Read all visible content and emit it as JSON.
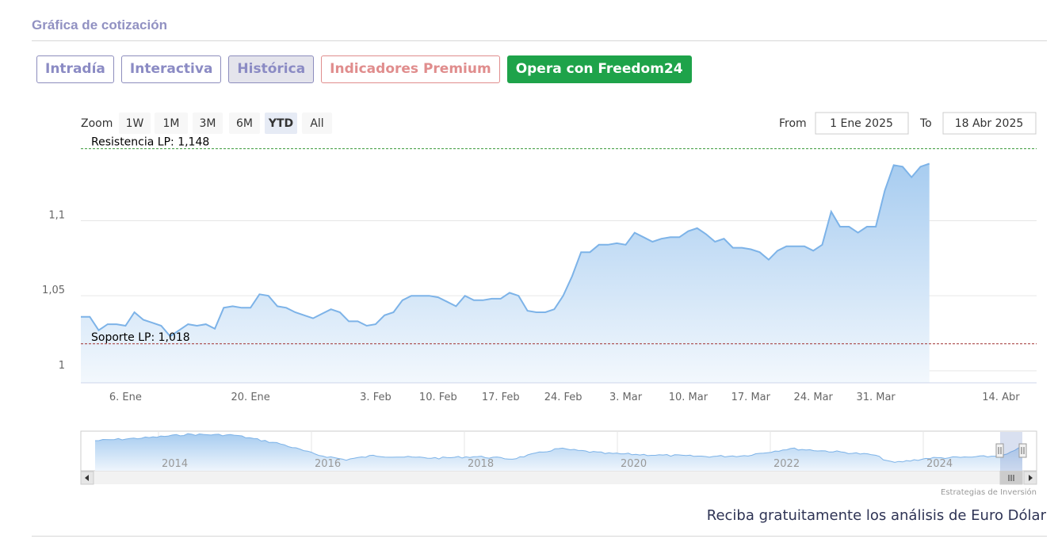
{
  "section": {
    "title": "Gráfica de cotización",
    "tabs": [
      {
        "label": "Intradía",
        "active": false
      },
      {
        "label": "Interactiva",
        "active": false
      },
      {
        "label": "Histórica",
        "active": true
      },
      {
        "label": "Indicadores Premium",
        "active": false
      },
      {
        "label": "Opera con Freedom24",
        "active": false
      }
    ]
  },
  "range_selector": {
    "zoom_label": "Zoom",
    "buttons": [
      "1W",
      "1M",
      "3M",
      "6M",
      "YTD",
      "All"
    ],
    "selected": "YTD",
    "from_label": "From",
    "from_value": "1 Ene 2025",
    "to_label": "To",
    "to_value": "18 Abr 2025"
  },
  "chart_data": {
    "type": "area",
    "ylim": [
      0.992,
      1.152
    ],
    "y_ticks": [
      {
        "value": 1.0,
        "label": "1"
      },
      {
        "value": 1.05,
        "label": "1,05"
      },
      {
        "value": 1.1,
        "label": "1,1"
      }
    ],
    "x_range": [
      0,
      107
    ],
    "x_ticks": [
      {
        "day": 5,
        "label": "6. Ene"
      },
      {
        "day": 19,
        "label": "20. Ene"
      },
      {
        "day": 33,
        "label": "3. Feb"
      },
      {
        "day": 40,
        "label": "10. Feb"
      },
      {
        "day": 47,
        "label": "17. Feb"
      },
      {
        "day": 54,
        "label": "24. Feb"
      },
      {
        "day": 61,
        "label": "3. Mar"
      },
      {
        "day": 68,
        "label": "10. Mar"
      },
      {
        "day": 75,
        "label": "17. Mar"
      },
      {
        "day": 82,
        "label": "24. Mar"
      },
      {
        "day": 89,
        "label": "31. Mar"
      },
      {
        "day": 103,
        "label": "14. Abr"
      }
    ],
    "series": [
      {
        "values": [
          [
            0,
            1.036
          ],
          [
            1,
            1.036
          ],
          [
            2,
            1.027
          ],
          [
            3,
            1.031
          ],
          [
            4,
            1.031
          ],
          [
            5,
            1.03
          ],
          [
            6,
            1.039
          ],
          [
            7,
            1.034
          ],
          [
            8,
            1.032
          ],
          [
            9,
            1.03
          ],
          [
            10,
            1.023
          ],
          [
            11,
            1.027
          ],
          [
            12,
            1.031
          ],
          [
            13,
            1.03
          ],
          [
            14,
            1.031
          ],
          [
            15,
            1.028
          ],
          [
            16,
            1.042
          ],
          [
            17,
            1.043
          ],
          [
            18,
            1.042
          ],
          [
            19,
            1.042
          ],
          [
            20,
            1.051
          ],
          [
            21,
            1.05
          ],
          [
            22,
            1.043
          ],
          [
            23,
            1.042
          ],
          [
            24,
            1.039
          ],
          [
            25,
            1.037
          ],
          [
            26,
            1.035
          ],
          [
            27,
            1.038
          ],
          [
            28,
            1.041
          ],
          [
            29,
            1.039
          ],
          [
            30,
            1.033
          ],
          [
            31,
            1.033
          ],
          [
            32,
            1.03
          ],
          [
            33,
            1.031
          ],
          [
            34,
            1.037
          ],
          [
            35,
            1.039
          ],
          [
            36,
            1.047
          ],
          [
            37,
            1.05
          ],
          [
            38,
            1.05
          ],
          [
            39,
            1.05
          ],
          [
            40,
            1.049
          ],
          [
            41,
            1.046
          ],
          [
            42,
            1.043
          ],
          [
            43,
            1.05
          ],
          [
            44,
            1.047
          ],
          [
            45,
            1.047
          ],
          [
            46,
            1.048
          ],
          [
            47,
            1.048
          ],
          [
            48,
            1.052
          ],
          [
            49,
            1.05
          ],
          [
            50,
            1.04
          ],
          [
            51,
            1.039
          ],
          [
            52,
            1.039
          ],
          [
            53,
            1.041
          ],
          [
            54,
            1.05
          ],
          [
            55,
            1.063
          ],
          [
            56,
            1.079
          ],
          [
            57,
            1.079
          ],
          [
            58,
            1.084
          ],
          [
            59,
            1.084
          ],
          [
            60,
            1.085
          ],
          [
            61,
            1.084
          ],
          [
            62,
            1.092
          ],
          [
            63,
            1.089
          ],
          [
            64,
            1.086
          ],
          [
            65,
            1.088
          ],
          [
            66,
            1.089
          ],
          [
            67,
            1.089
          ],
          [
            68,
            1.093
          ],
          [
            69,
            1.095
          ],
          [
            70,
            1.091
          ],
          [
            71,
            1.086
          ],
          [
            72,
            1.088
          ],
          [
            73,
            1.082
          ],
          [
            74,
            1.082
          ],
          [
            75,
            1.081
          ],
          [
            76,
            1.079
          ],
          [
            77,
            1.074
          ],
          [
            78,
            1.08
          ],
          [
            79,
            1.083
          ],
          [
            80,
            1.083
          ],
          [
            81,
            1.083
          ],
          [
            82,
            1.08
          ],
          [
            83,
            1.084
          ],
          [
            84,
            1.106
          ],
          [
            85,
            1.096
          ],
          [
            86,
            1.096
          ],
          [
            87,
            1.092
          ],
          [
            88,
            1.096
          ],
          [
            89,
            1.096
          ],
          [
            90,
            1.12
          ],
          [
            91,
            1.137
          ],
          [
            92,
            1.136
          ],
          [
            93,
            1.129
          ],
          [
            94,
            1.136
          ],
          [
            95,
            1.138
          ]
        ]
      }
    ],
    "annotations": [
      {
        "label": "Resistencia LP: 1,148",
        "value": 1.148,
        "color": "#3a9a3a"
      },
      {
        "label": "Soporte LP: 1,018",
        "value": 1.018,
        "color": "#a03030"
      }
    ],
    "navigator": {
      "year_labels": [
        "2014",
        "2016",
        "2018",
        "2020",
        "2022",
        "2024"
      ]
    },
    "colors": {
      "line": "#7db3e8",
      "fill_top": "#a7ccf0",
      "fill_bottom": "#f3f8fd",
      "grid": "#e6e6e6"
    },
    "grid": true,
    "legend": "none"
  },
  "credits": "Estrategias de Inversión",
  "footer": {
    "cta": "Reciba gratuitamente los análisis de Euro Dólar"
  }
}
